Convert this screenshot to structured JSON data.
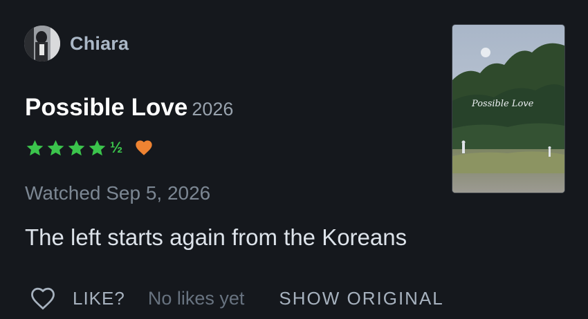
{
  "review": {
    "user": {
      "name": "Chiara"
    },
    "film": {
      "title": "Possible Love",
      "year": "2026",
      "poster_title": "Possible Love"
    },
    "rating": {
      "stars": 4.5,
      "half_glyph": "½",
      "liked": true
    },
    "watched_text": "Watched Sep 5, 2026",
    "body": "The left starts again from the Koreans"
  },
  "actions": {
    "like_label": "LIKE?",
    "likes_text": "No likes yet",
    "show_original_label": "SHOW ORIGINAL"
  },
  "colors": {
    "background": "#15181d",
    "star_green": "#3bc44c",
    "heart_orange": "#ee8332",
    "username": "#aab7c6"
  }
}
